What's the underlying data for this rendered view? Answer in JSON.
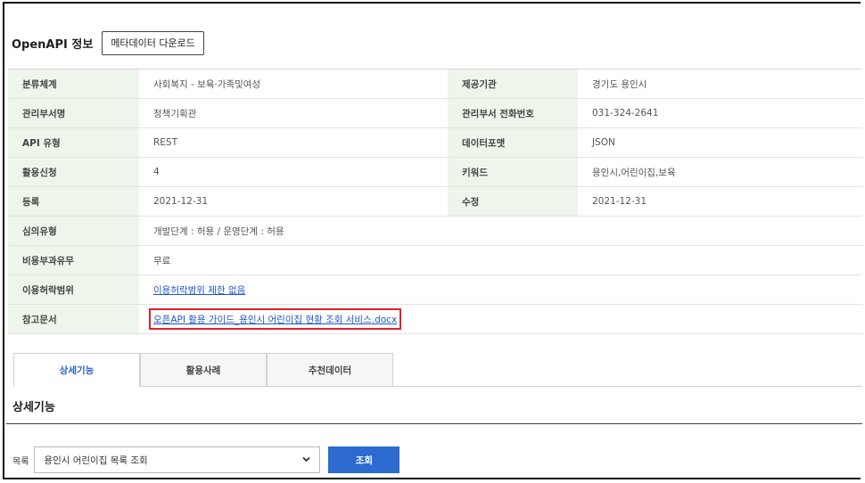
{
  "header": {
    "title": "OpenAPI 정보",
    "metadata_download_label": "메타데이터 다운로드"
  },
  "info": {
    "category_label": "분류체계",
    "category_value": "사회복지 - 보육·가족및여성",
    "provider_label": "제공기관",
    "provider_value": "경기도 용인시",
    "dept_label": "관리부서명",
    "dept_value": "정책기획관",
    "dept_phone_label": "관리부서 전화번호",
    "dept_phone_value": "031-324-2641",
    "api_type_label": "API 유형",
    "api_type_value": "REST",
    "data_format_label": "데이터포맷",
    "data_format_value": "JSON",
    "usage_requests_label": "활용신청",
    "usage_requests_value": "4",
    "keywords_label": "키워드",
    "keywords_value": "용인시,어린이집,보육",
    "registered_label": "등록",
    "registered_value": "2021-12-31",
    "modified_label": "수정",
    "modified_value": "2021-12-31",
    "review_type_label": "심의유형",
    "review_type_value": "개발단계 : 허용 / 운영단계 : 허용",
    "fee_label": "비용부과유무",
    "fee_value": "무료",
    "license_label": "이용허락범위",
    "license_value": "이용허락범위 제한 없음",
    "reference_label": "참고문서",
    "reference_value": "오픈API 활용 가이드_용인시 어린이집 현황 조회 서비스.docx"
  },
  "tabs": [
    "상세기능",
    "활용사례",
    "추천데이터"
  ],
  "detail": {
    "section_title": "상세기능",
    "select_label": "목록",
    "selected_option": "용인시 어린이집 목록 조회",
    "search_button": "조회"
  },
  "colors": {
    "header_cell_bg": "#eef5ea",
    "link": "#1f56c8",
    "highlight_border": "#e0202a",
    "primary_button": "#2e6bd1",
    "active_tab_text": "#2a63c7"
  }
}
